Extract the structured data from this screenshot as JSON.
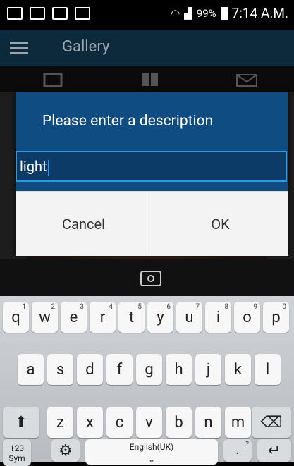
{
  "status_bar": {
    "battery": "99%",
    "time": "7:14 A.M."
  },
  "app": {
    "title": "Gallery"
  },
  "dialog": {
    "title": "Please enter a description",
    "input_value": "light",
    "cancel_label": "Cancel",
    "ok_label": "OK"
  },
  "keyboard": {
    "row1": [
      {
        "k": "q",
        "s": "1"
      },
      {
        "k": "w",
        "s": "2"
      },
      {
        "k": "e",
        "s": "3"
      },
      {
        "k": "r",
        "s": "4"
      },
      {
        "k": "t",
        "s": "5"
      },
      {
        "k": "y",
        "s": "6"
      },
      {
        "k": "u",
        "s": "7"
      },
      {
        "k": "i",
        "s": "8"
      },
      {
        "k": "o",
        "s": "9"
      },
      {
        "k": "p",
        "s": "0"
      }
    ],
    "row2": [
      "a",
      "s",
      "d",
      "f",
      "g",
      "h",
      "j",
      "k",
      "l"
    ],
    "row3": [
      "z",
      "x",
      "c",
      "v",
      "b",
      "n",
      "m"
    ],
    "sym_label_top": "123",
    "sym_label_bottom": "Sym",
    "space_label": "English(UK)",
    "period_label": ".",
    "period_sup": "?"
  }
}
